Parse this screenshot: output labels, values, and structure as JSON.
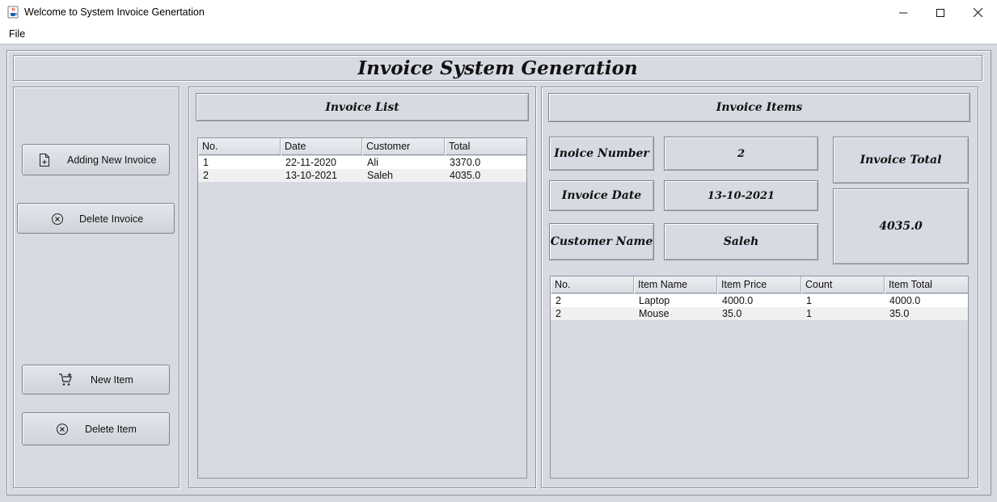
{
  "window": {
    "title": "Welcome to System Invoice Genertation"
  },
  "menu": {
    "file_label": "File"
  },
  "header": {
    "title": "Invoice System Generation"
  },
  "left_panel": {
    "add_invoice_label": "Adding New Invoice",
    "delete_invoice_label": "Delete Invoice",
    "new_item_label": "New Item",
    "delete_item_label": "Delete Item"
  },
  "invoice_list": {
    "title": "Invoice List",
    "columns": [
      "No.",
      "Date",
      "Customer",
      "Total"
    ],
    "rows": [
      [
        "1",
        "22-11-2020",
        "Ali",
        "3370.0"
      ],
      [
        "2",
        "13-10-2021",
        "Saleh",
        "4035.0"
      ]
    ]
  },
  "invoice_items": {
    "title": "Invoice Items",
    "number_label": "Inoice Number",
    "number_value": "2",
    "date_label": "Invoice Date",
    "date_value": "13-10-2021",
    "customer_label": "Customer Name",
    "customer_value": "Saleh",
    "total_label": "Invoice Total",
    "total_value": "4035.0",
    "columns": [
      "No.",
      "Item Name",
      "Item Price",
      "Count",
      "Item Total"
    ],
    "rows": [
      [
        "2",
        "Laptop",
        "4000.0",
        "1",
        "4000.0"
      ],
      [
        "2",
        "Mouse",
        "35.0",
        "1",
        "35.0"
      ]
    ]
  },
  "icons": {
    "app": "java-cup-icon",
    "add_invoice": "file-plus-icon",
    "delete_invoice": "circle-x-icon",
    "new_item": "cart-plus-icon",
    "delete_item": "circle-x-icon"
  }
}
